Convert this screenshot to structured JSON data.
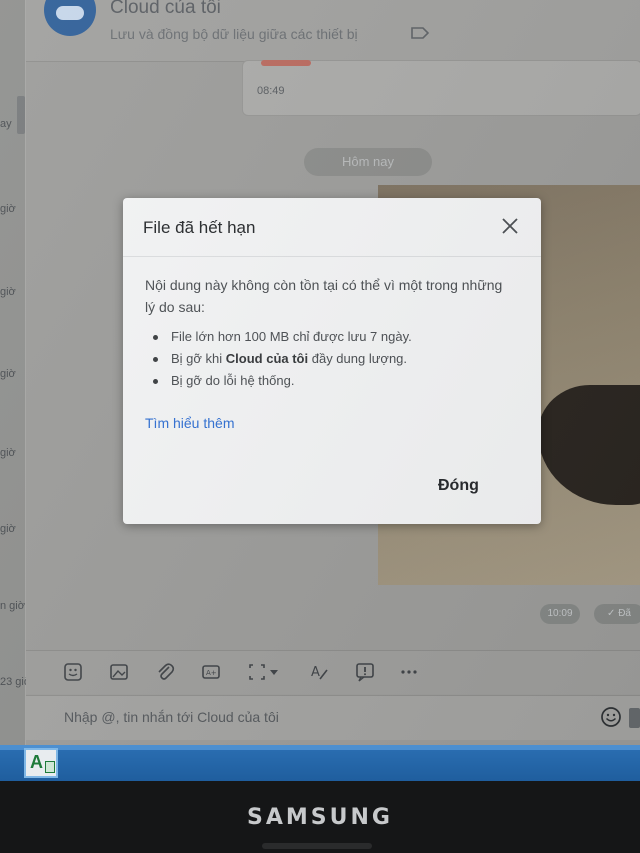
{
  "chat": {
    "title": "Cloud của tôi",
    "subtitle": "Lưu và đồng bộ dữ liệu giữa các thiết bị",
    "message_time": "08:49",
    "date_divider": "Hôm nay",
    "time_pill_1": "10:09",
    "time_pill_2": "Đã"
  },
  "sidebar_times": [
    "ay",
    "giờ",
    "giờ",
    "giờ",
    "giờ",
    "giờ",
    "n giờ",
    "23 giờ"
  ],
  "dialog": {
    "title": "File đã hết hạn",
    "intro": "Nội dung này không còn tồn tại có thể vì một trong những lý do sau:",
    "reasons": [
      {
        "before": "File lớn hơn 100 MB chỉ được lưu 7 ngày.",
        "bold": "",
        "after": ""
      },
      {
        "before": "Bị gỡ khi ",
        "bold": "Cloud của tôi",
        "after": " đầy dung lượng."
      },
      {
        "before": "Bị gỡ do lỗi hệ thống.",
        "bold": "",
        "after": ""
      }
    ],
    "learn_more": "Tìm hiểu thêm",
    "close_label": "Đóng"
  },
  "composer": {
    "placeholder": "Nhập @, tin nhắn tới Cloud của tôi"
  },
  "monitor": {
    "brand": "SAMSUNG"
  },
  "colors": {
    "link": "#2f6fd3",
    "taskbar": "#2b6fb3",
    "avatar": "#2f5f98"
  }
}
